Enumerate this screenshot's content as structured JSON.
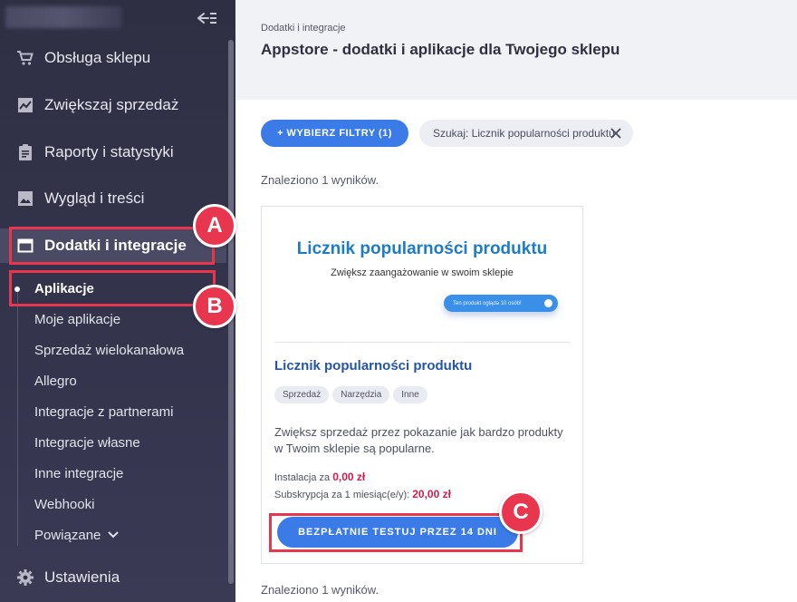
{
  "sidebar": {
    "items": [
      {
        "label": "Obsługa sklepu",
        "icon": "cart-icon"
      },
      {
        "label": "Zwiększaj sprzedaż",
        "icon": "chart-icon"
      },
      {
        "label": "Raporty i statystyki",
        "icon": "clipboard-icon"
      },
      {
        "label": "Wygląd i treści",
        "icon": "image-icon"
      },
      {
        "label": "Dodatki i integracje",
        "icon": "window-icon"
      }
    ],
    "sub_items": [
      "Aplikacje",
      "Moje aplikacje",
      "Sprzedaż wielokanałowa",
      "Allegro",
      "Integracje z partnerami",
      "Integracje własne",
      "Inne integracje",
      "Webhooki",
      "Powiązane"
    ],
    "settings_label": "Ustawienia"
  },
  "annotations": {
    "a": "A",
    "b": "B",
    "c": "C"
  },
  "header": {
    "breadcrumb": "Dodatki i integracje",
    "title": "Appstore - dodatki i aplikacje dla Twojego sklepu"
  },
  "filters": {
    "button_label": "+ WYBIERZ FILTRY (1)",
    "chip_label": "Szukaj: Licznik popularności produktu"
  },
  "results": {
    "found_text": "Znaleziono 1 wyników.",
    "found_text_bottom": "Znaleziono 1 wyników."
  },
  "card": {
    "banner_title": "Licznik popularności produktu",
    "banner_subtitle": "Zwiększ zaangażowanie w swoim sklepie",
    "banner_pill": "Ten produkt ogląda 10 osób!",
    "title": "Licznik popularności produktu",
    "tags": [
      "Sprzedaż",
      "Narzędzia",
      "Inne"
    ],
    "description": "Zwiększ sprzedaż przez pokazanie jak bardzo produkty w Twoim sklepie są popularne.",
    "install_label": "Instalacja za",
    "install_price": "0,00 zł",
    "sub_label": "Subskrypcja za 1 miesiąc(e/y):",
    "sub_price": "20,00 zł",
    "cta_label": "BEZPŁATNIE TESTUJ PRZEZ 14 DNI"
  },
  "colors": {
    "accent": "#3b7be8",
    "highlight": "#e8364f",
    "price": "#d8194a",
    "sidebar": "#2f2f44"
  }
}
